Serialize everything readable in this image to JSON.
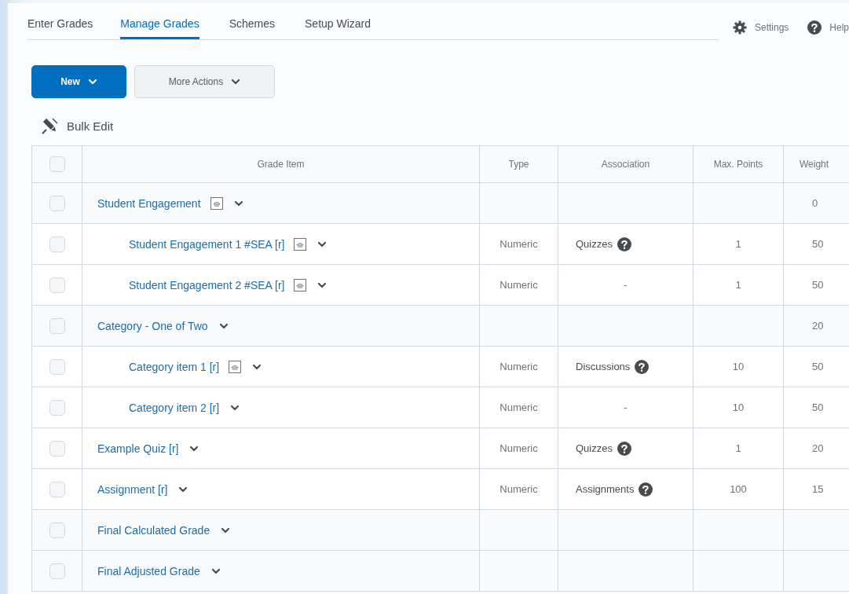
{
  "tabs": [
    {
      "label": "Enter Grades",
      "selected": false
    },
    {
      "label": "Manage Grades",
      "selected": true
    },
    {
      "label": "Schemes",
      "selected": false
    },
    {
      "label": "Setup Wizard",
      "selected": false
    }
  ],
  "header_links": [
    {
      "kind": "settings",
      "label": "Settings"
    },
    {
      "kind": "help",
      "label": "Help"
    }
  ],
  "buttons": [
    {
      "kind": "primary",
      "label": "New"
    },
    {
      "kind": "secondary",
      "label": "More Actions"
    }
  ],
  "bulk_edit": "Bulk Edit",
  "table": {
    "select_all_checked": false,
    "columns": [
      "Grade Item",
      "Type",
      "Association",
      "Max. Points",
      "Weight"
    ],
    "rows": [
      {
        "kind": "category",
        "name": "Student Engagement",
        "preview_icon": true,
        "checked": false,
        "weight": "0",
        "children": [
          {
            "kind": "item",
            "name": "Student Engagement 1 #SEA [r]",
            "preview_icon": true,
            "checked": false,
            "type": "Numeric",
            "association": "Quizzes",
            "association_help": true,
            "max_points": "1",
            "weight": "50"
          },
          {
            "kind": "item",
            "name": "Student Engagement 2 #SEA [r]",
            "preview_icon": true,
            "checked": false,
            "type": "Numeric",
            "association": "-",
            "association_help": false,
            "max_points": "1",
            "weight": "50"
          }
        ]
      },
      {
        "kind": "category",
        "name": "Category - One of Two",
        "preview_icon": false,
        "checked": false,
        "weight": "20",
        "children": [
          {
            "kind": "item",
            "name": "Category item 1 [r]",
            "preview_icon": true,
            "checked": false,
            "type": "Numeric",
            "association": "Discussions",
            "association_help": true,
            "max_points": "10",
            "weight": "50"
          },
          {
            "kind": "item",
            "name": "Category item 2 [r]",
            "preview_icon": false,
            "checked": false,
            "type": "Numeric",
            "association": "-",
            "association_help": false,
            "max_points": "10",
            "weight": "50"
          }
        ]
      },
      {
        "kind": "item",
        "name": "Example Quiz [r]",
        "preview_icon": false,
        "checked": false,
        "type": "Numeric",
        "association": "Quizzes",
        "association_help": true,
        "max_points": "1",
        "weight": "20"
      },
      {
        "kind": "item",
        "name": "Assignment [r]",
        "preview_icon": false,
        "checked": false,
        "type": "Numeric",
        "association": "Assignments",
        "association_help": true,
        "max_points": "100",
        "weight": "15"
      },
      {
        "kind": "final",
        "name": "Final Calculated Grade",
        "preview_icon": false,
        "checked": false
      },
      {
        "kind": "final",
        "name": "Final Adjusted Grade",
        "preview_icon": false,
        "checked": false
      }
    ]
  }
}
